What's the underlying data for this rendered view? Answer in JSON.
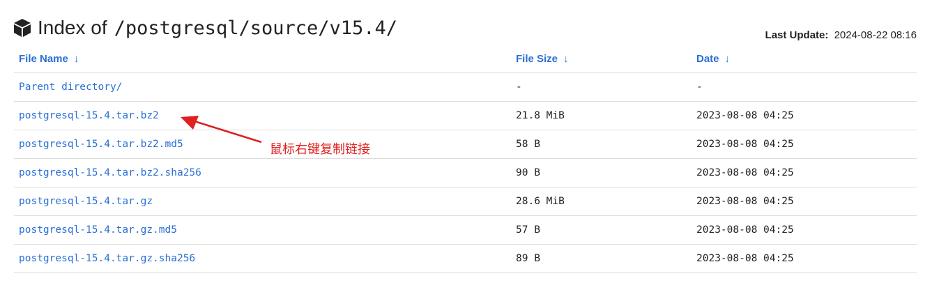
{
  "header": {
    "title_label": "Index of",
    "title_path": "/postgresql/source/v15.4/",
    "last_update_label": "Last Update:",
    "last_update_value": "2024-08-22 08:16"
  },
  "table": {
    "columns": [
      {
        "label": "File Name",
        "sort_icon": "arrow-down-icon"
      },
      {
        "label": "File Size",
        "sort_icon": "arrow-down-icon"
      },
      {
        "label": "Date",
        "sort_icon": "arrow-down-icon"
      }
    ],
    "rows": [
      {
        "name": "Parent directory/",
        "size": "-",
        "date": "-"
      },
      {
        "name": "postgresql-15.4.tar.bz2",
        "size": "21.8 MiB",
        "date": "2023-08-08 04:25"
      },
      {
        "name": "postgresql-15.4.tar.bz2.md5",
        "size": "58 B",
        "date": "2023-08-08 04:25"
      },
      {
        "name": "postgresql-15.4.tar.bz2.sha256",
        "size": "90 B",
        "date": "2023-08-08 04:25"
      },
      {
        "name": "postgresql-15.4.tar.gz",
        "size": "28.6 MiB",
        "date": "2023-08-08 04:25"
      },
      {
        "name": "postgresql-15.4.tar.gz.md5",
        "size": "57 B",
        "date": "2023-08-08 04:25"
      },
      {
        "name": "postgresql-15.4.tar.gz.sha256",
        "size": "89 B",
        "date": "2023-08-08 04:25"
      }
    ]
  },
  "annotation": {
    "text": "鼠标右键复制链接",
    "color": "#e02020"
  },
  "colors": {
    "link": "#2a6fd6",
    "text": "#222222",
    "divider": "#dddddd"
  }
}
